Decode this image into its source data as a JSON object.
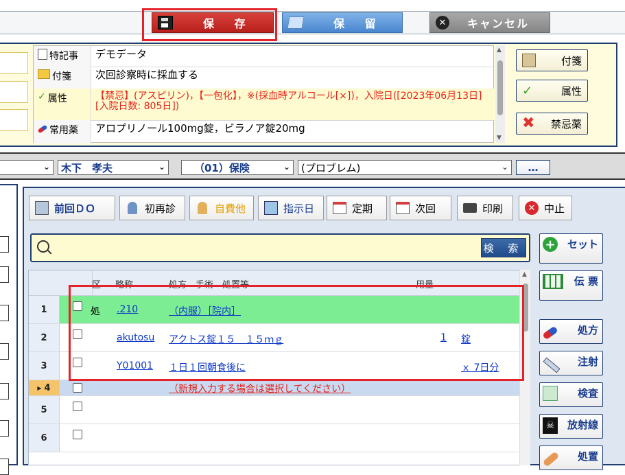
{
  "toolbar_top": {
    "save_label": "保 存",
    "hold_label": "保 留",
    "cancel_label": "キャンセル"
  },
  "notes": {
    "rows": [
      {
        "label": "特記事",
        "value": "デモデータ"
      },
      {
        "label": "付箋",
        "value": "次回診察時に採血する"
      },
      {
        "label": "属性",
        "value": "【禁忌】(アスピリン)，【一包化】，※(採血時アルコール[×])，入院日([2023年06月13日][入院日数: 805日])"
      },
      {
        "label": "常用薬",
        "value": "アロプリノール100mg錠，ビラノア錠20mg"
      }
    ],
    "side_buttons": [
      "付箋",
      "属性",
      "禁忌薬"
    ]
  },
  "selectors": {
    "doctor": "木下　孝夫",
    "insurance": "（01）保険",
    "problem": "(プロブレム)",
    "more_button": "…"
  },
  "main_toolbar": {
    "buttons": [
      "前回ＤＯ",
      "初再診",
      "自費他",
      "指示日",
      "定期",
      "次回",
      "印刷",
      "中止"
    ]
  },
  "search": {
    "button_label": "検 索",
    "set_button_label": "セット"
  },
  "grid": {
    "headers": [
      "区",
      "略称",
      "処方　手術　処置等",
      "用量"
    ],
    "rows": [
      {
        "num": "1",
        "kubun": "処",
        "abbr": ".210",
        "content": "（内服）［院内］",
        "qty": "",
        "unit": ""
      },
      {
        "num": "2",
        "kubun": "",
        "abbr": "akutosu",
        "content": "アクトス錠１５　１５ｍｇ",
        "qty": "1",
        "unit": "錠"
      },
      {
        "num": "3",
        "kubun": "",
        "abbr": "Y01001",
        "content": "１日１回朝食後に",
        "qty": "",
        "unit": "ｘ 7日分"
      },
      {
        "num": "4",
        "kubun": "",
        "abbr": "",
        "content": "（新規入力する場合は選択してください）",
        "qty": "",
        "unit": ""
      },
      {
        "num": "5",
        "kubun": "",
        "abbr": "",
        "content": "",
        "qty": "",
        "unit": ""
      },
      {
        "num": "6",
        "kubun": "",
        "abbr": "",
        "content": "",
        "qty": "",
        "unit": ""
      }
    ]
  },
  "right_buttons": [
    "伝 票",
    "処方",
    "注射",
    "検査",
    "放射線",
    "処置"
  ],
  "colors": {
    "accent_red": "#e5222a",
    "nav_blue": "#1f3e72",
    "row1_green": "#7ded94",
    "row4_blue": "#c9daf0"
  }
}
